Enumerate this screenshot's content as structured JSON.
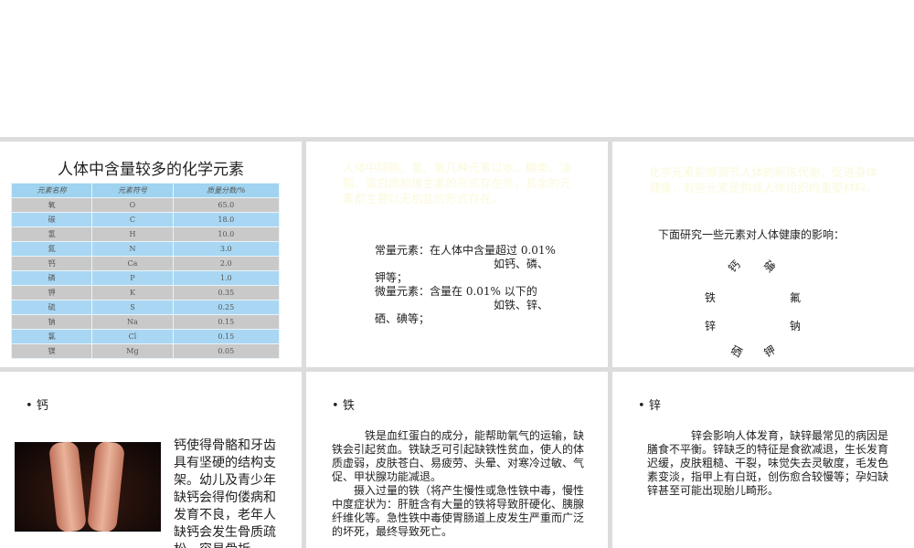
{
  "panel1": {
    "title": "人体中含量较多的化学元素",
    "table": {
      "headers": [
        "元素名称",
        "元素符号",
        "质量分数/%"
      ],
      "rows": [
        [
          "氧",
          "O",
          "65.0"
        ],
        [
          "碳",
          "C",
          "18.0"
        ],
        [
          "氢",
          "H",
          "10.0"
        ],
        [
          "氮",
          "N",
          "3.0"
        ],
        [
          "钙",
          "Ca",
          "2.0"
        ],
        [
          "磷",
          "P",
          "1.0"
        ],
        [
          "钾",
          "K",
          "0.35"
        ],
        [
          "硫",
          "S",
          "0.25"
        ],
        [
          "钠",
          "Na",
          "0.15"
        ],
        [
          "氯",
          "Cl",
          "0.15"
        ],
        [
          "镁",
          "Mg",
          "0.05"
        ]
      ]
    }
  },
  "panel2": {
    "faint": "人体中除碳、氢、氧几种元素以水、糖类、油脂、蛋白质和维生素的形式存在外，其余的元素都主要以无机盐的形式存在。",
    "l1": "常量元素：在人体中含量超过 0.01%",
    "l2": "如钙、磷、",
    "l3": "钾等；",
    "l4": "微量元素：含量在 0.01% 以下的",
    "l5": "如铁、锌、",
    "l6": "硒、碘等；"
  },
  "panel3": {
    "faint": "化学元素能够调节人体的新陈代谢，促进身体健康，有些元素是构成人体组织的重要材料。",
    "intro": "下面研究一些元素对人体健康的影响：",
    "circle": [
      "钙",
      "碘",
      "铁",
      "氟",
      "锌",
      "钠",
      "硒",
      "钾"
    ]
  },
  "panel4": {
    "bullet": "钙",
    "text": "钙使得骨骼和牙齿具有坚硬的结构支架。幼儿及青少年缺钙会得佝偻病和发育不良，老年人缺钙会发生骨质疏松，容易骨折。"
  },
  "panel5": {
    "bullet": "铁",
    "p1": "铁是血红蛋白的成分，能帮助氧气的运输，缺铁会引起贫血。铁缺乏可引起缺铁性贫血，使人的体质虚弱，皮肤苍白、易疲劳、头晕、对寒冷过敏、气促、甲状腺功能减退。",
    "p2": "摄入过量的铁（将产生慢性或急性铁中毒，慢性中度症状为：肝脏含有大量的铁将导致肝硬化、胰腺纤维化等。急性铁中毒使胃肠道上皮发生严重而广泛的坏死，最终导致死亡。"
  },
  "panel6": {
    "bullet": "锌",
    "text": "锌会影响人体发育，缺锌最常见的病因是膳食不平衡。锌缺乏的特征是食欲减退，生长发育迟缓，皮肤粗糙、干裂，味觉失去灵敏度，毛发色素变淡，指甲上有白斑，创伤愈合较慢等；孕妇缺锌甚至可能出现胎儿畸形。"
  }
}
